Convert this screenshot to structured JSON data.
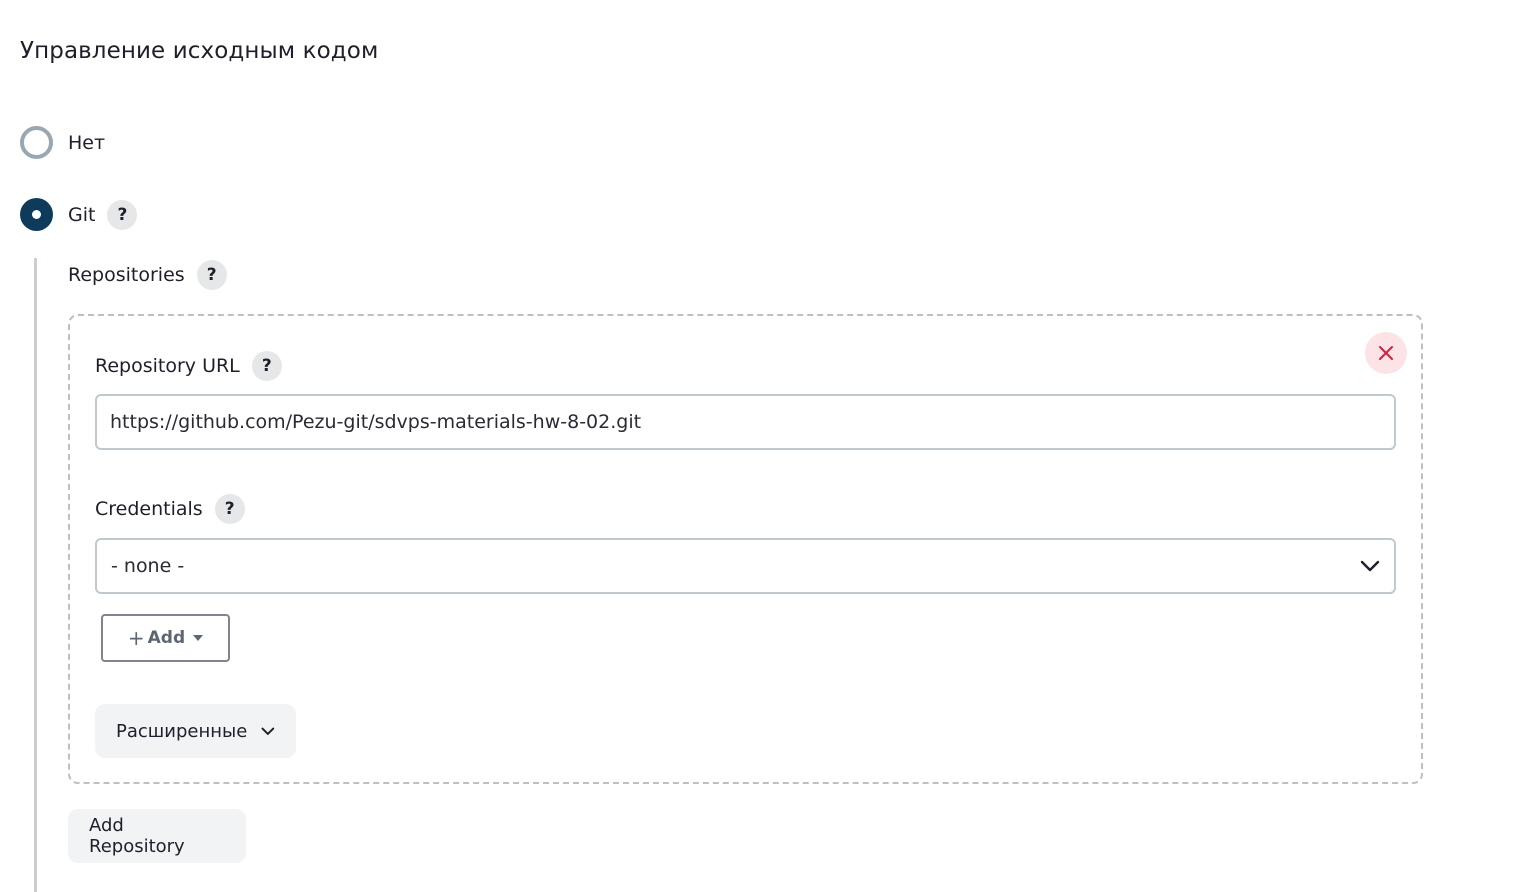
{
  "section": {
    "title": "Управление исходным кодом"
  },
  "scm_options": [
    {
      "label": "Нет",
      "checked": false
    },
    {
      "label": "Git",
      "checked": true
    }
  ],
  "git": {
    "help_label": "?",
    "repositories_label": "Repositories",
    "repository": {
      "url_label": "Repository URL",
      "url_value": "https://github.com/Pezu-git/sdvps-materials-hw-8-02.git",
      "credentials_label": "Credentials",
      "credentials_selected": "- none -",
      "add_label": "Add",
      "advanced_label": "Расширенные",
      "delete_icon": "close-icon"
    },
    "add_repository_label": "Add Repository"
  },
  "colors": {
    "radio_checked": "#0e3a5c",
    "radio_unchecked": "#9aa6b0",
    "delete_bg": "#fbe3e6",
    "delete_icon": "#d0213f"
  }
}
